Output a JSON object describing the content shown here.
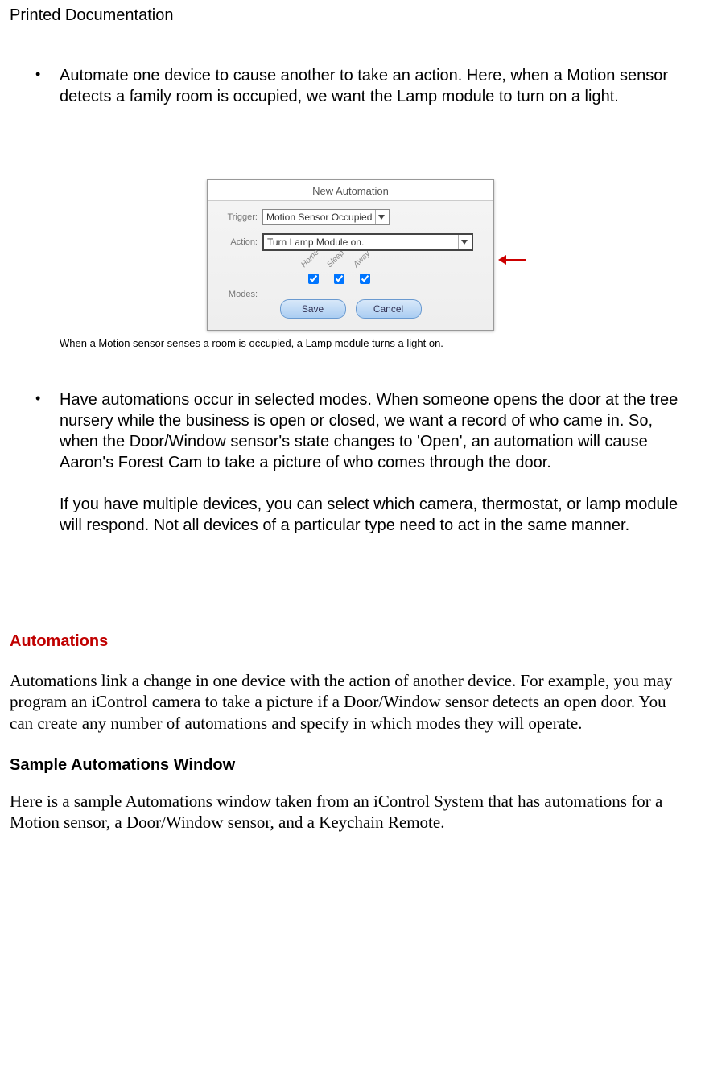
{
  "header": "Printed Documentation",
  "bullet1": "Automate one device to cause another to take an action. Here, when a Motion sensor detects a family room is occupied, we want the Lamp module to turn on a light.",
  "automation": {
    "panel_title": "New Automation",
    "trigger_label": "Trigger:",
    "trigger_value": "Motion Sensor Occupied",
    "action_label": "Action:",
    "action_value": "Turn Lamp Module on.",
    "modes_label": "Modes:",
    "modes": {
      "home_label": "Home",
      "sleep_label": "Sleep",
      "away_label": "Away",
      "home_checked": true,
      "sleep_checked": true,
      "away_checked": true
    },
    "save_label": "Save",
    "cancel_label": "Cancel"
  },
  "caption1": "When a Motion sensor senses a room is occupied, a Lamp module turns a light on.",
  "bullet2_p1": "Have automations occur in selected modes. When someone opens the door at the tree nursery while the business is open or closed, we want a record of who came in. So, when the Door/Window sensor's state changes to 'Open', an automation will cause Aaron's Forest Cam to take a picture of who comes through the door.",
  "bullet2_p2": "If you have multiple devices, you can select which camera, thermostat, or lamp module will respond. Not all devices of a particular type need to act in the same manner.",
  "section_heading": "Automations",
  "section_body": "Automations link a change in one device with the action of another device. For example, you may program an iControl camera to take a picture if a Door/Window sensor detects an open door. You can create any number of automations and specify in which modes they will operate.",
  "subheading": "Sample Automations Window",
  "sub_body": "Here is a sample Automations window taken from an iControl System that has automations for a Motion sensor, a Door/Window sensor, and a Keychain Remote."
}
